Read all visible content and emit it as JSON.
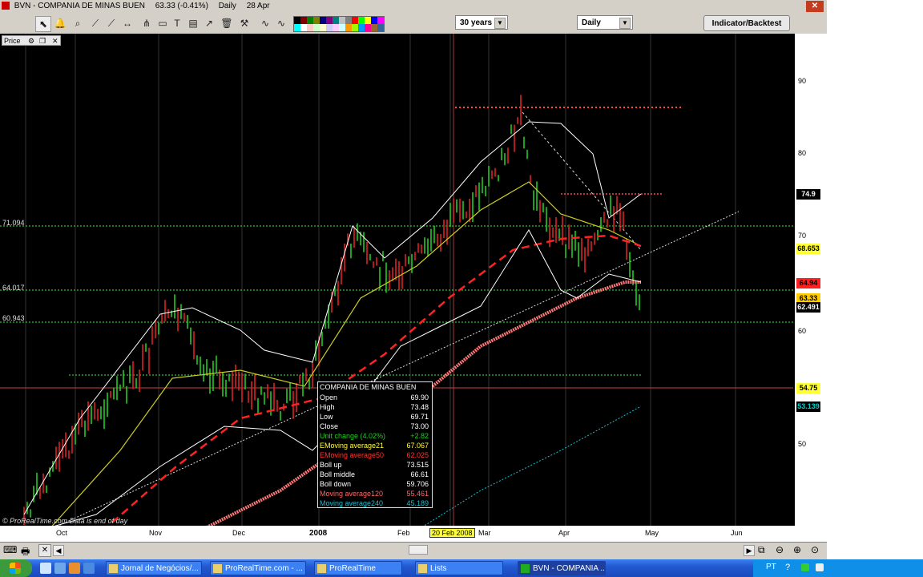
{
  "window": {
    "title_symbol": "BVN - COMPANIA DE MINAS BUEN",
    "title_quote": "63.33 (-0.41%)",
    "title_period": "Daily",
    "title_date": "28 Apr"
  },
  "toolbar": {
    "range_select": "30 years",
    "interval_select": "Daily",
    "indicator_button": "Indicator/Backtest"
  },
  "chart": {
    "panel_label": "Price",
    "left_labels": [
      "71.094",
      "64.017",
      "60.943"
    ],
    "y_ticks": [
      "90",
      "80",
      "70",
      "60",
      "50"
    ],
    "x_ticks": [
      "Oct",
      "Nov",
      "Dec",
      "2008",
      "Feb",
      "Mar",
      "Apr",
      "May",
      "Jun"
    ],
    "highlight_date": "20 Feb 2008",
    "badges": [
      {
        "value": "74.9",
        "bg": "#000000",
        "fg": "#ffffff"
      },
      {
        "value": "68.653",
        "bg": "#ffff33",
        "fg": "#000000"
      },
      {
        "value": "64.94",
        "bg": "#ff2020",
        "fg": "#000000"
      },
      {
        "value": "63.33",
        "bg": "#ffcc00",
        "fg": "#000000"
      },
      {
        "value": "62.491",
        "bg": "#000000",
        "fg": "#ffffff"
      },
      {
        "value": "54.75",
        "bg": "#ffff33",
        "fg": "#000000"
      },
      {
        "value": "53.139",
        "bg": "#000000",
        "fg": "#00cccc"
      }
    ],
    "copyright": "© ProRealTime.com  Data is end of day"
  },
  "tooltip": {
    "title": "COMPANIA DE MINAS BUEN",
    "rows": [
      {
        "k": "Open",
        "v": "69.90",
        "color": "#ffffff"
      },
      {
        "k": "High",
        "v": "73.48",
        "color": "#ffffff"
      },
      {
        "k": "Low",
        "v": "69.71",
        "color": "#ffffff"
      },
      {
        "k": "Close",
        "v": "73.00",
        "color": "#ffffff"
      },
      {
        "k": "Unit change (4.02%)",
        "v": "+2.82",
        "color": "#22cc22"
      },
      {
        "k": "EMoving average21",
        "v": "67.067",
        "color": "#ffff44"
      },
      {
        "k": "EMoving average50",
        "v": "62.025",
        "color": "#ff3333"
      },
      {
        "k": "Boll up",
        "v": "73.515",
        "color": "#ffffff"
      },
      {
        "k": "Boll middle",
        "v": "66.61",
        "color": "#ffffff"
      },
      {
        "k": "Boll down",
        "v": "59.706",
        "color": "#ffffff"
      },
      {
        "k": "Moving average120",
        "v": "55.461",
        "color": "#ff6666"
      },
      {
        "k": "Moving average240",
        "v": "45.189",
        "color": "#22bbcc"
      }
    ]
  },
  "taskbar": {
    "items": [
      "Jornal de Negócios/...",
      "ProRealTime.com - ...",
      "ProRealTime",
      "Lists",
      "BVN - COMPANIA ..."
    ],
    "lang": "PT"
  },
  "colors": {
    "candle_up": "#22cc22",
    "candle_down": "#dd2222",
    "ema21": "#cccc22",
    "ema50": "#ff2222",
    "ma120": "#ff7777",
    "ma240": "#22bbcc",
    "boll": "#ffffff",
    "hline": "#44ee44"
  }
}
